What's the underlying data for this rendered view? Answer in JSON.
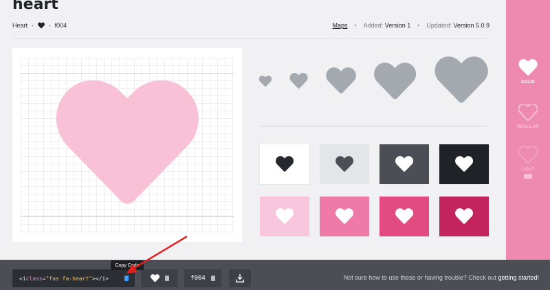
{
  "page": {
    "title": "heart"
  },
  "meta": {
    "name": "Heart",
    "unicode": "f004",
    "maps_label": "Maps",
    "added_label": "Added:",
    "added_version": "Version 1",
    "updated_label": "Updated:",
    "updated_version": "Version 5.0.9"
  },
  "sidebar": {
    "items": [
      {
        "label": "SOLID",
        "icon": "heart-solid-icon",
        "active": true
      },
      {
        "label": "REGULAR",
        "icon": "heart-regular-icon",
        "active": false
      },
      {
        "label": "LIGHT",
        "icon": "heart-light-icon",
        "active": false,
        "badge": "pro"
      }
    ]
  },
  "swatches": [
    {
      "bg": "#ffffff",
      "fg": "#25282c"
    },
    {
      "bg": "#e3e6e8",
      "fg": "#4b4e55"
    },
    {
      "bg": "#4b4e55",
      "fg": "#ffffff"
    },
    {
      "bg": "#1f2226",
      "fg": "#ffffff"
    },
    {
      "bg": "#f8c6dc",
      "fg": "#ffffff"
    },
    {
      "bg": "#ee7aa8",
      "fg": "#ffffff"
    },
    {
      "bg": "#e14b7f",
      "fg": "#ffffff"
    },
    {
      "bg": "#c3245c",
      "fg": "#ffffff"
    }
  ],
  "colors": {
    "accent": "#ee8ab0",
    "preview_heart": "#f9c1d6",
    "size_heart": "#a4a9af",
    "bottombar": "#4b4e55",
    "copy_icon": "#3ea0ff"
  },
  "bottombar": {
    "code_open": "<i ",
    "code_attr": "class",
    "code_eq": "=",
    "code_value": "\"fas fa-heart\"",
    "code_close": "></i>",
    "unicode": "f004",
    "help_text": "Not sure how to use these or having trouble? Check out",
    "help_link": "getting started!"
  },
  "tooltip": {
    "text": "Copy Code"
  }
}
